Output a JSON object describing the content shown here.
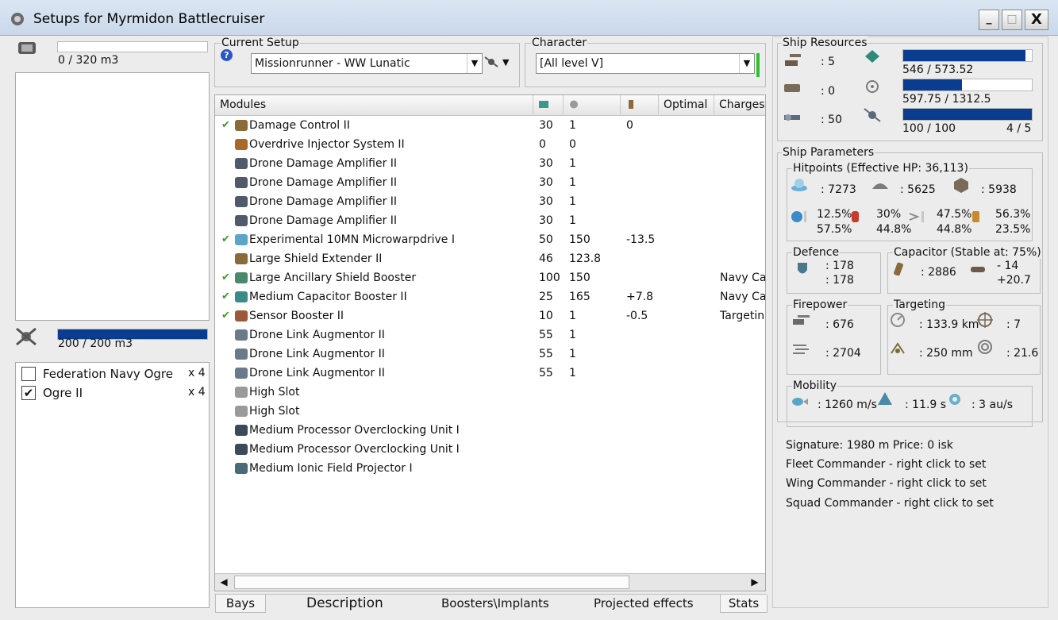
{
  "window": {
    "title": "Setups for Myrmidon Battlecruiser",
    "minimize": "_",
    "maximize": "□",
    "close": "X"
  },
  "cargo": {
    "capacity_text": "0 / 320 m3",
    "fill": 0.0
  },
  "drone_bay": {
    "capacity_text": "200 / 200 m3",
    "fill": 1.0
  },
  "drones": [
    {
      "name": "Federation Navy Ogre",
      "qty": "x 4",
      "checked": false
    },
    {
      "name": "Ogre II",
      "qty": "x 4",
      "checked": true
    }
  ],
  "current_setup": {
    "label": "Current Setup",
    "help": "?",
    "value": "Missionrunner - WW Lunatic"
  },
  "character": {
    "label": "Character",
    "value": "[All level V]"
  },
  "modules": {
    "headers": {
      "name": "Modules",
      "optimal": "Optimal",
      "charges": "Charges"
    },
    "rows": [
      {
        "checked": true,
        "name": "Damage Control II",
        "cpu": "30",
        "pg": "1",
        "cap": "0",
        "optimal": "",
        "charges": "",
        "icon": "#8a6a3a"
      },
      {
        "checked": false,
        "name": "Overdrive Injector System II",
        "cpu": "0",
        "pg": "0",
        "cap": "",
        "optimal": "",
        "charges": "",
        "icon": "#a8682a"
      },
      {
        "checked": false,
        "name": "Drone Damage Amplifier II",
        "cpu": "30",
        "pg": "1",
        "cap": "",
        "optimal": "",
        "charges": "",
        "icon": "#505a6a"
      },
      {
        "checked": false,
        "name": "Drone Damage Amplifier II",
        "cpu": "30",
        "pg": "1",
        "cap": "",
        "optimal": "",
        "charges": "",
        "icon": "#505a6a"
      },
      {
        "checked": false,
        "name": "Drone Damage Amplifier II",
        "cpu": "30",
        "pg": "1",
        "cap": "",
        "optimal": "",
        "charges": "",
        "icon": "#505a6a"
      },
      {
        "checked": false,
        "name": "Drone Damage Amplifier II",
        "cpu": "30",
        "pg": "1",
        "cap": "",
        "optimal": "",
        "charges": "",
        "icon": "#505a6a"
      },
      {
        "checked": true,
        "name": "Experimental 10MN Microwarpdrive I",
        "cpu": "50",
        "pg": "150",
        "cap": "-13.5",
        "optimal": "",
        "charges": "",
        "icon": "#5aa6c8"
      },
      {
        "checked": false,
        "name": "Large Shield Extender II",
        "cpu": "46",
        "pg": "123.8",
        "cap": "",
        "optimal": "",
        "charges": "",
        "icon": "#8a6a3a"
      },
      {
        "checked": true,
        "name": "Large Ancillary Shield Booster",
        "cpu": "100",
        "pg": "150",
        "cap": "",
        "optimal": "",
        "charges": "Navy Ca",
        "icon": "#4a8a6a"
      },
      {
        "checked": true,
        "name": "Medium Capacitor Booster II",
        "cpu": "25",
        "pg": "165",
        "cap": "+7.8",
        "optimal": "",
        "charges": "Navy Ca",
        "icon": "#3a8a8a"
      },
      {
        "checked": true,
        "name": "Sensor Booster II",
        "cpu": "10",
        "pg": "1",
        "cap": "-0.5",
        "optimal": "",
        "charges": "Targetin",
        "icon": "#9a5a3a"
      },
      {
        "checked": false,
        "name": "Drone Link Augmentor II",
        "cpu": "55",
        "pg": "1",
        "cap": "",
        "optimal": "",
        "charges": "",
        "icon": "#6a7a8a"
      },
      {
        "checked": false,
        "name": "Drone Link Augmentor II",
        "cpu": "55",
        "pg": "1",
        "cap": "",
        "optimal": "",
        "charges": "",
        "icon": "#6a7a8a"
      },
      {
        "checked": false,
        "name": "Drone Link Augmentor II",
        "cpu": "55",
        "pg": "1",
        "cap": "",
        "optimal": "",
        "charges": "",
        "icon": "#6a7a8a"
      },
      {
        "checked": false,
        "name": "High Slot",
        "cpu": "",
        "pg": "",
        "cap": "",
        "optimal": "",
        "charges": "",
        "icon": "#9a9a9a"
      },
      {
        "checked": false,
        "name": "High Slot",
        "cpu": "",
        "pg": "",
        "cap": "",
        "optimal": "",
        "charges": "",
        "icon": "#9a9a9a"
      },
      {
        "checked": false,
        "name": "Medium Processor Overclocking Unit I",
        "cpu": "",
        "pg": "",
        "cap": "",
        "optimal": "",
        "charges": "",
        "icon": "#3a4a5a"
      },
      {
        "checked": false,
        "name": "Medium Processor Overclocking Unit I",
        "cpu": "",
        "pg": "",
        "cap": "",
        "optimal": "",
        "charges": "",
        "icon": "#3a4a5a"
      },
      {
        "checked": false,
        "name": "Medium Ionic Field Projector I",
        "cpu": "",
        "pg": "",
        "cap": "",
        "optimal": "",
        "charges": "",
        "icon": "#4a6a7a"
      }
    ]
  },
  "tabs": [
    "Bays",
    "Description",
    "Boosters\\Implants",
    "Projected effects",
    "Stats"
  ],
  "ship_resources": {
    "label": "Ship Resources",
    "turret_slots": ": 5",
    "launcher_slots": ": 0",
    "calibration": ": 50",
    "cpu_text": "546 / 573.52",
    "cpu_fill": 0.952,
    "powergrid_text": "597.75 / 1312.5",
    "powergrid_fill": 0.455,
    "bandwidth_text": "100 / 100",
    "bandwidth_fill": 1.0,
    "drones_text": "4 / 5"
  },
  "ship_parameters": {
    "label": "Ship Parameters",
    "hitpoints_label": "Hitpoints (Effective HP: 36,113)",
    "shield_hp": ": 7273",
    "armor_hp": ": 5625",
    "structure_hp": ": 5938",
    "resists": [
      {
        "top": "12.5%",
        "bottom": "57.5%"
      },
      {
        "top": "30%",
        "bottom": "44.8%"
      },
      {
        "top": "47.5%",
        "bottom": "44.8%"
      },
      {
        "top": "56.3%",
        "bottom": "23.5%"
      }
    ],
    "defence": {
      "label": "Defence",
      "a": ": 178",
      "b": ": 178"
    },
    "capacitor": {
      "label": "Capacitor (Stable at: 75%)",
      "capacity": ": 2886",
      "delta1": "- 14",
      "delta2": "+20.7"
    },
    "firepower": {
      "label": "Firepower",
      "a": ": 676",
      "b": ": 2704"
    },
    "targeting": {
      "label": "Targeting",
      "range": ": 133.9 km",
      "max_targets": ": 7",
      "scan_res": ": 250 mm",
      "sensor": ": 21.6"
    },
    "mobility": {
      "label": "Mobility",
      "speed": ": 1260 m/s",
      "align": ": 11.9 s",
      "warp": ": 3 au/s"
    },
    "signature_line": "Signature: 1980 m  Price: 0 isk",
    "fleet_commander": "Fleet Commander - right click to set",
    "wing_commander": "Wing Commander - right click to set",
    "squad_commander": "Squad Commander - right click to set"
  },
  "colors": {
    "bar_fill": "#0a3d8f",
    "check": "#3a9b27",
    "title_bg": "#c9d8ea"
  }
}
